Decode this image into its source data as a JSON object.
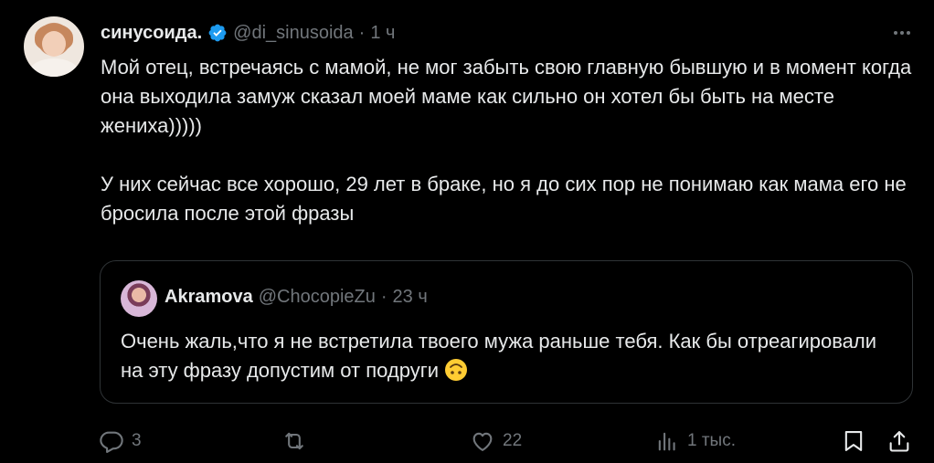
{
  "tweet": {
    "author_name": "синусоида.",
    "handle": "@di_sinusoida",
    "separator": "·",
    "time": "1 ч",
    "paragraphs": [
      "Мой отец, встречаясь с мамой, не мог забыть свою главную бывшую и в момент когда она выходила замуж сказал моей маме как сильно он хотел бы быть на месте жениха)))))",
      "У них сейчас все хорошо, 29 лет в браке, но я до сих пор не понимаю как мама его не бросила после этой фразы"
    ]
  },
  "quote": {
    "author_name": "Akramova",
    "handle": "@ChocopieZu",
    "separator": "·",
    "time": "23 ч",
    "text": "Очень жаль,что я не встретила твоего мужа раньше тебя. Как бы отреагировали на эту фразу допустим от подруги"
  },
  "actions": {
    "replies": "3",
    "retweets": "",
    "likes": "22",
    "views": "1 тыс."
  },
  "colors": {
    "background": "#000000",
    "text": "#e7e9ea",
    "muted": "#71767b",
    "verified": "#1d9bf0",
    "border": "#2f3336"
  },
  "icons": {
    "verified": "verified-badge-icon",
    "more": "more-options-icon",
    "reply": "reply-bubble-icon",
    "retweet": "retweet-icon",
    "like": "heart-icon",
    "views": "views-bar-chart-icon",
    "bookmark": "bookmark-icon",
    "share": "share-icon",
    "emoji": "upside-down-face-emoji-icon"
  }
}
